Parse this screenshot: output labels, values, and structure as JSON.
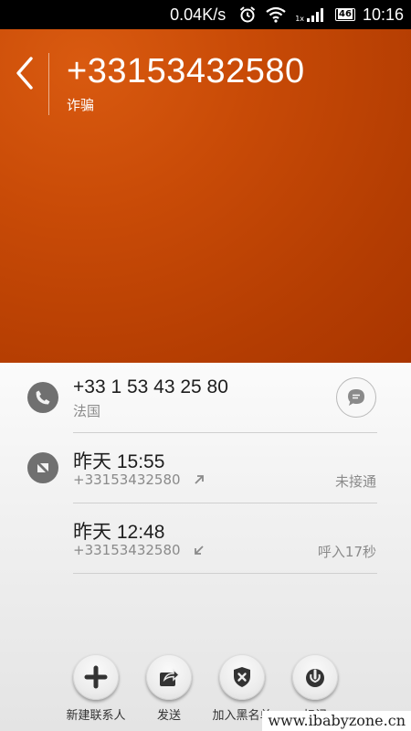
{
  "status_bar": {
    "speed": "0.04K/s",
    "network_label": "1x",
    "battery": "46",
    "time": "10:16",
    "icons": [
      "alarm-icon",
      "wifi-icon",
      "signal-icon",
      "battery-icon"
    ]
  },
  "header": {
    "title": "+33153432580",
    "tag": "诈骗",
    "background_color": "#c94b07"
  },
  "contact": {
    "number": "+33 1 53 43 25 80",
    "location": "法国"
  },
  "calls": [
    {
      "time": "昨天 15:55",
      "number": "+33153432580",
      "direction": "outgoing",
      "status": "未接通"
    },
    {
      "time": "昨天 12:48",
      "number": "+33153432580",
      "direction": "incoming",
      "status": "呼入17秒"
    }
  ],
  "toolbar": [
    {
      "label": "新建联系人",
      "icon": "plus-icon"
    },
    {
      "label": "发送",
      "icon": "share-icon"
    },
    {
      "label": "加入黑名单",
      "icon": "block-shield-icon"
    },
    {
      "label": "标记",
      "icon": "mark-icon"
    }
  ],
  "watermark": "www.ibabyzone.cn"
}
